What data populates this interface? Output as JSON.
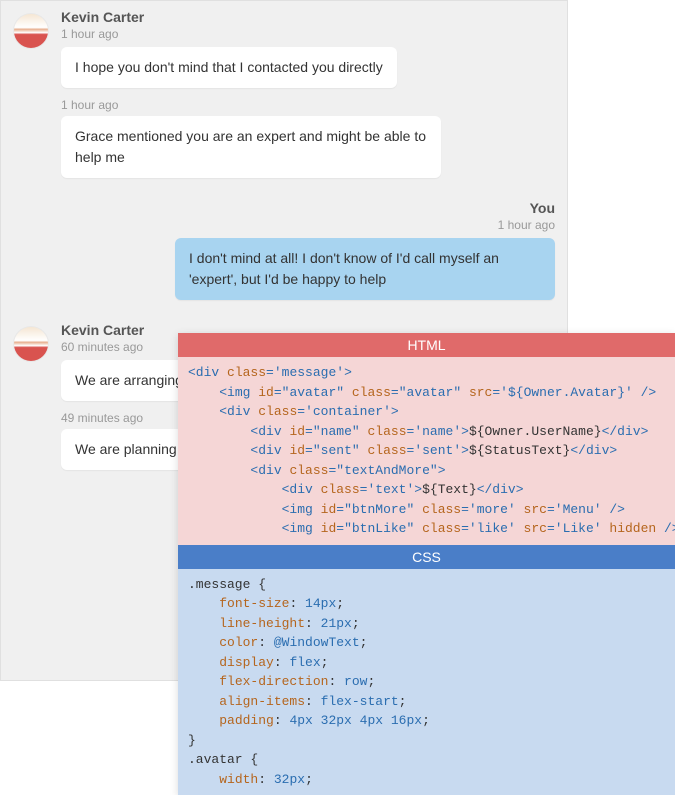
{
  "chat": {
    "groups": [
      {
        "type": "incoming",
        "sender": "Kevin Carter",
        "ts": "1 hour ago",
        "bubbles": [
          {
            "text": "I hope you don't mind that I contacted you directly"
          }
        ],
        "continuations": [
          {
            "ts": "1 hour ago",
            "text": "Grace mentioned you are an expert and might be able to help me"
          }
        ]
      },
      {
        "type": "outgoing",
        "sender": "You",
        "ts": "1 hour ago",
        "bubbles": [
          {
            "text": "I don't mind at all! I don't know of I'd call myself an 'expert', but I'd be happy to help"
          }
        ]
      },
      {
        "type": "incoming",
        "sender": "Kevin Carter",
        "ts": "60 minutes ago",
        "bubbles": [
          {
            "text": "We are arranging"
          }
        ],
        "continuations": [
          {
            "ts": "49 minutes ago",
            "text": "We are planning varying degrees"
          }
        ]
      }
    ]
  },
  "code_panel": {
    "html_header": "HTML",
    "css_header": "CSS",
    "html_lines": [
      {
        "indent": 0,
        "tokens": [
          {
            "c": "t-tag",
            "t": "<div "
          },
          {
            "c": "t-attr",
            "t": "class"
          },
          {
            "c": "t-tag",
            "t": "="
          },
          {
            "c": "t-val",
            "t": "'message'"
          },
          {
            "c": "t-tag",
            "t": ">"
          }
        ]
      },
      {
        "indent": 1,
        "tokens": [
          {
            "c": "t-tag",
            "t": "<img "
          },
          {
            "c": "t-attr",
            "t": "id"
          },
          {
            "c": "t-tag",
            "t": "="
          },
          {
            "c": "t-val",
            "t": "\"avatar\""
          },
          {
            "c": "t-tag",
            "t": " "
          },
          {
            "c": "t-attr",
            "t": "class"
          },
          {
            "c": "t-tag",
            "t": "="
          },
          {
            "c": "t-val",
            "t": "\"avatar\""
          },
          {
            "c": "t-tag",
            "t": " "
          },
          {
            "c": "t-attr",
            "t": "src"
          },
          {
            "c": "t-tag",
            "t": "="
          },
          {
            "c": "t-val",
            "t": "'${Owner.Avatar}'"
          },
          {
            "c": "t-tag",
            "t": " />"
          }
        ]
      },
      {
        "indent": 1,
        "tokens": [
          {
            "c": "t-tag",
            "t": "<div "
          },
          {
            "c": "t-attr",
            "t": "class"
          },
          {
            "c": "t-tag",
            "t": "="
          },
          {
            "c": "t-val",
            "t": "'container'"
          },
          {
            "c": "t-tag",
            "t": ">"
          }
        ]
      },
      {
        "indent": 2,
        "tokens": [
          {
            "c": "t-tag",
            "t": "<div "
          },
          {
            "c": "t-attr",
            "t": "id"
          },
          {
            "c": "t-tag",
            "t": "="
          },
          {
            "c": "t-val",
            "t": "\"name\""
          },
          {
            "c": "t-tag",
            "t": " "
          },
          {
            "c": "t-attr",
            "t": "class"
          },
          {
            "c": "t-tag",
            "t": "="
          },
          {
            "c": "t-val",
            "t": "'name'"
          },
          {
            "c": "t-tag",
            "t": ">"
          },
          {
            "c": "t-txt",
            "t": "${Owner.UserName}"
          },
          {
            "c": "t-tag",
            "t": "</div>"
          }
        ]
      },
      {
        "indent": 2,
        "tokens": [
          {
            "c": "t-tag",
            "t": "<div "
          },
          {
            "c": "t-attr",
            "t": "id"
          },
          {
            "c": "t-tag",
            "t": "="
          },
          {
            "c": "t-val",
            "t": "\"sent\""
          },
          {
            "c": "t-tag",
            "t": " "
          },
          {
            "c": "t-attr",
            "t": "class"
          },
          {
            "c": "t-tag",
            "t": "="
          },
          {
            "c": "t-val",
            "t": "'sent'"
          },
          {
            "c": "t-tag",
            "t": ">"
          },
          {
            "c": "t-txt",
            "t": "${StatusText}"
          },
          {
            "c": "t-tag",
            "t": "</div>"
          }
        ]
      },
      {
        "indent": 2,
        "tokens": [
          {
            "c": "t-tag",
            "t": "<div "
          },
          {
            "c": "t-attr",
            "t": "class"
          },
          {
            "c": "t-tag",
            "t": "="
          },
          {
            "c": "t-val",
            "t": "\"textAndMore\""
          },
          {
            "c": "t-tag",
            "t": ">"
          }
        ]
      },
      {
        "indent": 3,
        "tokens": [
          {
            "c": "t-tag",
            "t": "<div "
          },
          {
            "c": "t-attr",
            "t": "class"
          },
          {
            "c": "t-tag",
            "t": "="
          },
          {
            "c": "t-val",
            "t": "'text'"
          },
          {
            "c": "t-tag",
            "t": ">"
          },
          {
            "c": "t-txt",
            "t": "${Text}"
          },
          {
            "c": "t-tag",
            "t": "</div>"
          }
        ]
      },
      {
        "indent": 3,
        "tokens": [
          {
            "c": "t-tag",
            "t": "<img "
          },
          {
            "c": "t-attr",
            "t": "id"
          },
          {
            "c": "t-tag",
            "t": "="
          },
          {
            "c": "t-val",
            "t": "\"btnMore\""
          },
          {
            "c": "t-tag",
            "t": " "
          },
          {
            "c": "t-attr",
            "t": "class"
          },
          {
            "c": "t-tag",
            "t": "="
          },
          {
            "c": "t-val",
            "t": "'more'"
          },
          {
            "c": "t-tag",
            "t": " "
          },
          {
            "c": "t-attr",
            "t": "src"
          },
          {
            "c": "t-tag",
            "t": "="
          },
          {
            "c": "t-val",
            "t": "'Menu'"
          },
          {
            "c": "t-tag",
            "t": " />"
          }
        ]
      },
      {
        "indent": 3,
        "tokens": [
          {
            "c": "t-tag",
            "t": "<img "
          },
          {
            "c": "t-attr",
            "t": "id"
          },
          {
            "c": "t-tag",
            "t": "="
          },
          {
            "c": "t-val",
            "t": "\"btnLike\""
          },
          {
            "c": "t-tag",
            "t": " "
          },
          {
            "c": "t-attr",
            "t": "class"
          },
          {
            "c": "t-tag",
            "t": "="
          },
          {
            "c": "t-val",
            "t": "'like'"
          },
          {
            "c": "t-tag",
            "t": " "
          },
          {
            "c": "t-attr",
            "t": "src"
          },
          {
            "c": "t-tag",
            "t": "="
          },
          {
            "c": "t-val",
            "t": "'Like'"
          },
          {
            "c": "t-tag",
            "t": " "
          },
          {
            "c": "t-attr",
            "t": "hidden"
          },
          {
            "c": "t-tag",
            "t": " />"
          }
        ]
      }
    ],
    "css_lines": [
      {
        "indent": 0,
        "tokens": [
          {
            "c": "t-sel",
            "t": ".message {"
          }
        ]
      },
      {
        "indent": 1,
        "tokens": [
          {
            "c": "t-prop",
            "t": "font-size"
          },
          {
            "c": "t-sel",
            "t": ": "
          },
          {
            "c": "t-pval",
            "t": "14px"
          },
          {
            "c": "t-sel",
            "t": ";"
          }
        ]
      },
      {
        "indent": 1,
        "tokens": [
          {
            "c": "t-prop",
            "t": "line-height"
          },
          {
            "c": "t-sel",
            "t": ": "
          },
          {
            "c": "t-pval",
            "t": "21px"
          },
          {
            "c": "t-sel",
            "t": ";"
          }
        ]
      },
      {
        "indent": 1,
        "tokens": [
          {
            "c": "t-prop",
            "t": "color"
          },
          {
            "c": "t-sel",
            "t": ": "
          },
          {
            "c": "t-pval",
            "t": "@WindowText"
          },
          {
            "c": "t-sel",
            "t": ";"
          }
        ]
      },
      {
        "indent": 1,
        "tokens": [
          {
            "c": "t-prop",
            "t": "display"
          },
          {
            "c": "t-sel",
            "t": ": "
          },
          {
            "c": "t-pval",
            "t": "flex"
          },
          {
            "c": "t-sel",
            "t": ";"
          }
        ]
      },
      {
        "indent": 1,
        "tokens": [
          {
            "c": "t-prop",
            "t": "flex-direction"
          },
          {
            "c": "t-sel",
            "t": ": "
          },
          {
            "c": "t-pval",
            "t": "row"
          },
          {
            "c": "t-sel",
            "t": ";"
          }
        ]
      },
      {
        "indent": 1,
        "tokens": [
          {
            "c": "t-prop",
            "t": "align-items"
          },
          {
            "c": "t-sel",
            "t": ": "
          },
          {
            "c": "t-pval",
            "t": "flex-start"
          },
          {
            "c": "t-sel",
            "t": ";"
          }
        ]
      },
      {
        "indent": 1,
        "tokens": [
          {
            "c": "t-prop",
            "t": "padding"
          },
          {
            "c": "t-sel",
            "t": ": "
          },
          {
            "c": "t-pval",
            "t": "4px 32px 4px 16px"
          },
          {
            "c": "t-sel",
            "t": ";"
          }
        ]
      },
      {
        "indent": 0,
        "tokens": [
          {
            "c": "t-sel",
            "t": "}"
          }
        ]
      },
      {
        "indent": 0,
        "tokens": [
          {
            "c": "t-sel",
            "t": ""
          }
        ]
      },
      {
        "indent": 0,
        "tokens": [
          {
            "c": "t-sel",
            "t": ".avatar {"
          }
        ]
      },
      {
        "indent": 1,
        "tokens": [
          {
            "c": "t-prop",
            "t": "width"
          },
          {
            "c": "t-sel",
            "t": ": "
          },
          {
            "c": "t-pval",
            "t": "32px"
          },
          {
            "c": "t-sel",
            "t": ";"
          }
        ]
      }
    ]
  }
}
